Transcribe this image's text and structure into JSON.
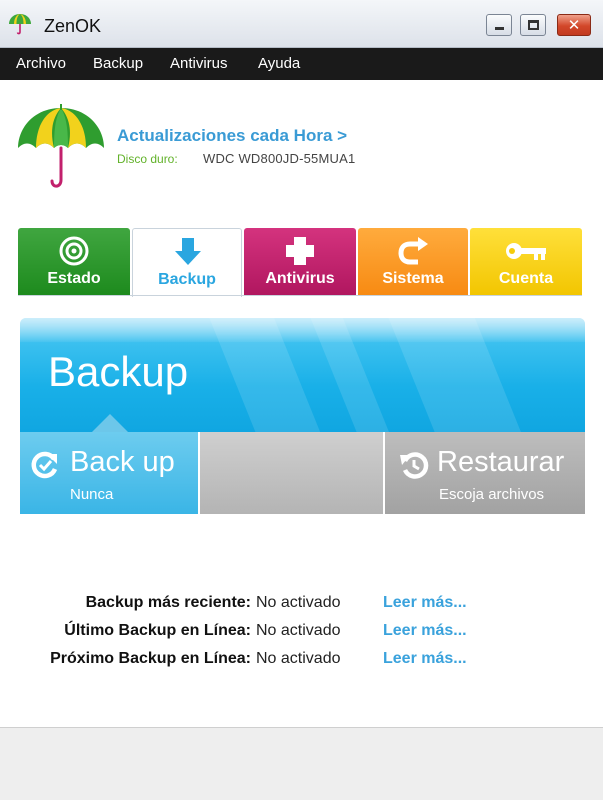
{
  "window": {
    "title": "ZenOK",
    "icon": "umbrella-icon",
    "controls": {
      "minimize": "minimize-icon",
      "maximize": "maximize-icon",
      "close_glyph": "✕"
    }
  },
  "menu": {
    "items": [
      "Archivo",
      "Backup",
      "Antivirus",
      "Ayuda"
    ]
  },
  "header": {
    "update_link": "Actualizaciones cada Hora >",
    "disk_label": "Disco duro:",
    "disk_value": "WDC WD800JD-55MUA1"
  },
  "tabs": [
    {
      "label": "Estado",
      "icon": "target-icon",
      "color": "#2a962a"
    },
    {
      "label": "Backup",
      "icon": "download-arrow-icon",
      "color": "#2aa6e0",
      "selected": true
    },
    {
      "label": "Antivirus",
      "icon": "plus-icon",
      "color": "#c2206c"
    },
    {
      "label": "Sistema",
      "icon": "refresh-icon",
      "color": "#f89a22"
    },
    {
      "label": "Cuenta",
      "icon": "key-icon",
      "color": "#f5cc0a"
    }
  ],
  "banner": {
    "title": "Backup"
  },
  "actions": {
    "backup": {
      "title": "Back up",
      "subtitle": "Nunca",
      "icon": "backup-icon"
    },
    "restore": {
      "title": "Restaurar",
      "subtitle": "Escoja archivos",
      "icon": "restore-icon"
    }
  },
  "info": [
    {
      "label": "Backup más reciente:",
      "value": "No activado",
      "link": "Leer más..."
    },
    {
      "label": "Último Backup en Línea:",
      "value": "No activado",
      "link": "Leer más..."
    },
    {
      "label": "Próximo Backup en Línea:",
      "value": "No activado",
      "link": "Leer más..."
    }
  ],
  "colors": {
    "accent_blue": "#2aa6e0",
    "link_blue": "#3a9bd5",
    "disk_label_green": "#62b22a"
  }
}
